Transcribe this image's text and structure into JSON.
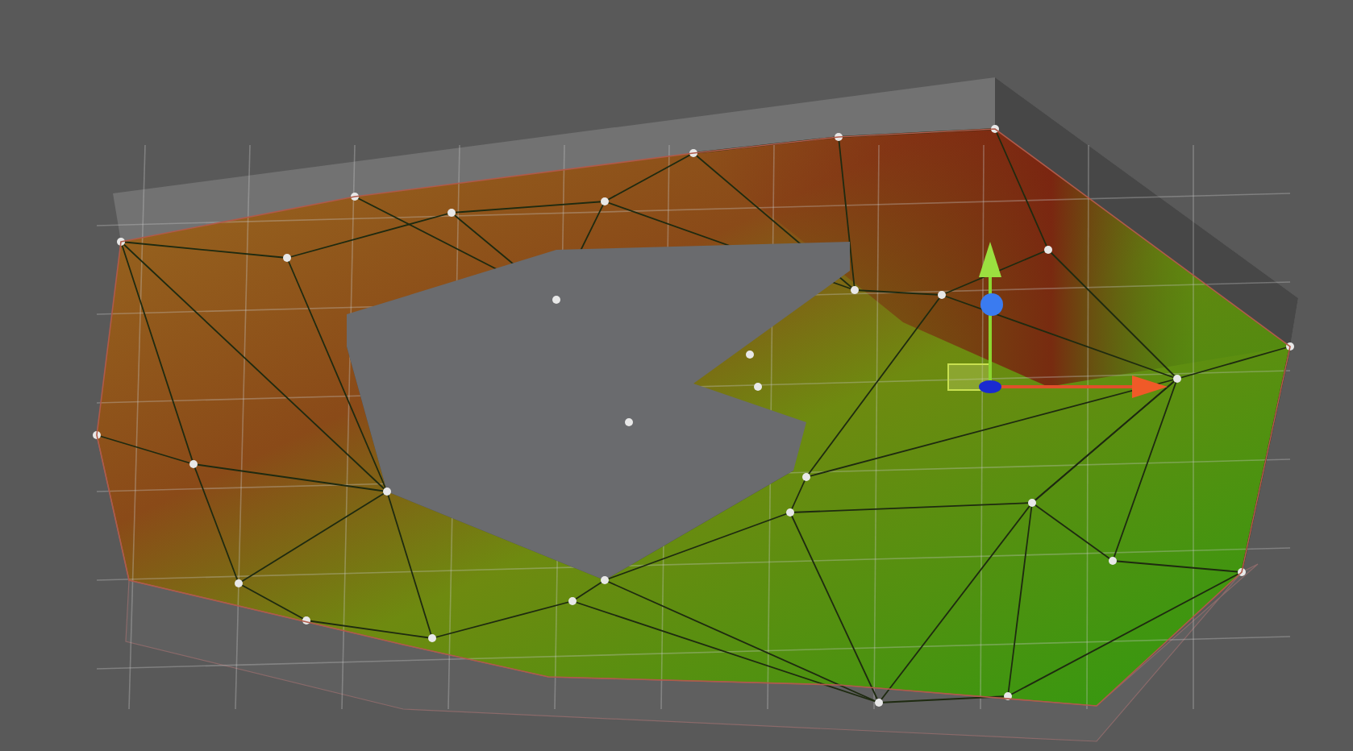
{
  "scene_view": {
    "gizmo": {
      "kind": "move"
    }
  }
}
